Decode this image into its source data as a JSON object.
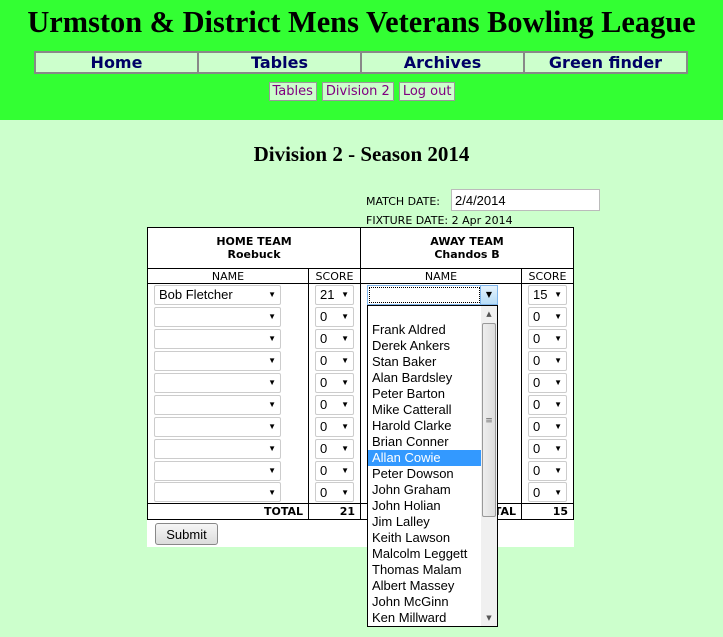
{
  "header": {
    "title": "Urmston & District Mens Veterans Bowling League",
    "nav": [
      "Home",
      "Tables",
      "Archives",
      "Green finder"
    ],
    "subnav": [
      "Tables",
      "Division 2",
      "Log out"
    ]
  },
  "page": {
    "heading": "Division 2 - Season 2014",
    "match_date_label": "MATCH DATE:",
    "match_date_value": "2/4/2014",
    "fixture_date": "FIXTURE DATE: 2 Apr 2014"
  },
  "table": {
    "home_label": "HOME TEAM",
    "home_team": "Roebuck",
    "away_label": "AWAY TEAM",
    "away_team": "Chandos B",
    "col_name": "NAME",
    "col_score": "SCORE",
    "total_label": "TOTAL",
    "total_label_partial": "AL",
    "home_total": "21",
    "away_total": "15",
    "rows": [
      {
        "home_name": "Bob Fletcher",
        "home_score": "21",
        "away_name": "",
        "away_score": "15"
      },
      {
        "home_name": "",
        "home_score": "0",
        "away_name": "",
        "away_score": "0"
      },
      {
        "home_name": "",
        "home_score": "0",
        "away_name": "",
        "away_score": "0"
      },
      {
        "home_name": "",
        "home_score": "0",
        "away_name": "",
        "away_score": "0"
      },
      {
        "home_name": "",
        "home_score": "0",
        "away_name": "",
        "away_score": "0"
      },
      {
        "home_name": "",
        "home_score": "0",
        "away_name": "",
        "away_score": "0"
      },
      {
        "home_name": "",
        "home_score": "0",
        "away_name": "",
        "away_score": "0"
      },
      {
        "home_name": "",
        "home_score": "0",
        "away_name": "",
        "away_score": "0"
      },
      {
        "home_name": "",
        "home_score": "0",
        "away_name": "",
        "away_score": "0"
      },
      {
        "home_name": "",
        "home_score": "0",
        "away_name": "",
        "away_score": "0"
      }
    ]
  },
  "submit_label": "Submit",
  "dropdown": {
    "options": [
      "",
      "Frank Aldred",
      "Derek Ankers",
      "Stan Baker",
      "Alan Bardsley",
      "Peter Barton",
      "Mike Catterall",
      "Harold Clarke",
      "Brian Conner",
      "Allan Cowie",
      "Peter Dowson",
      "John Graham",
      "John Holian",
      "Jim Lalley",
      "Keith Lawson",
      "Malcolm Leggett",
      "Thomas Malam",
      "Albert Massey",
      "John McGinn",
      "Ken Millward"
    ],
    "highlighted": "Allan Cowie"
  },
  "colors": {
    "header_bg": "#33ff33",
    "page_bg": "#ccffcc",
    "nav_text": "#000066",
    "subnav_text": "#800080",
    "highlight": "#3399ff"
  }
}
